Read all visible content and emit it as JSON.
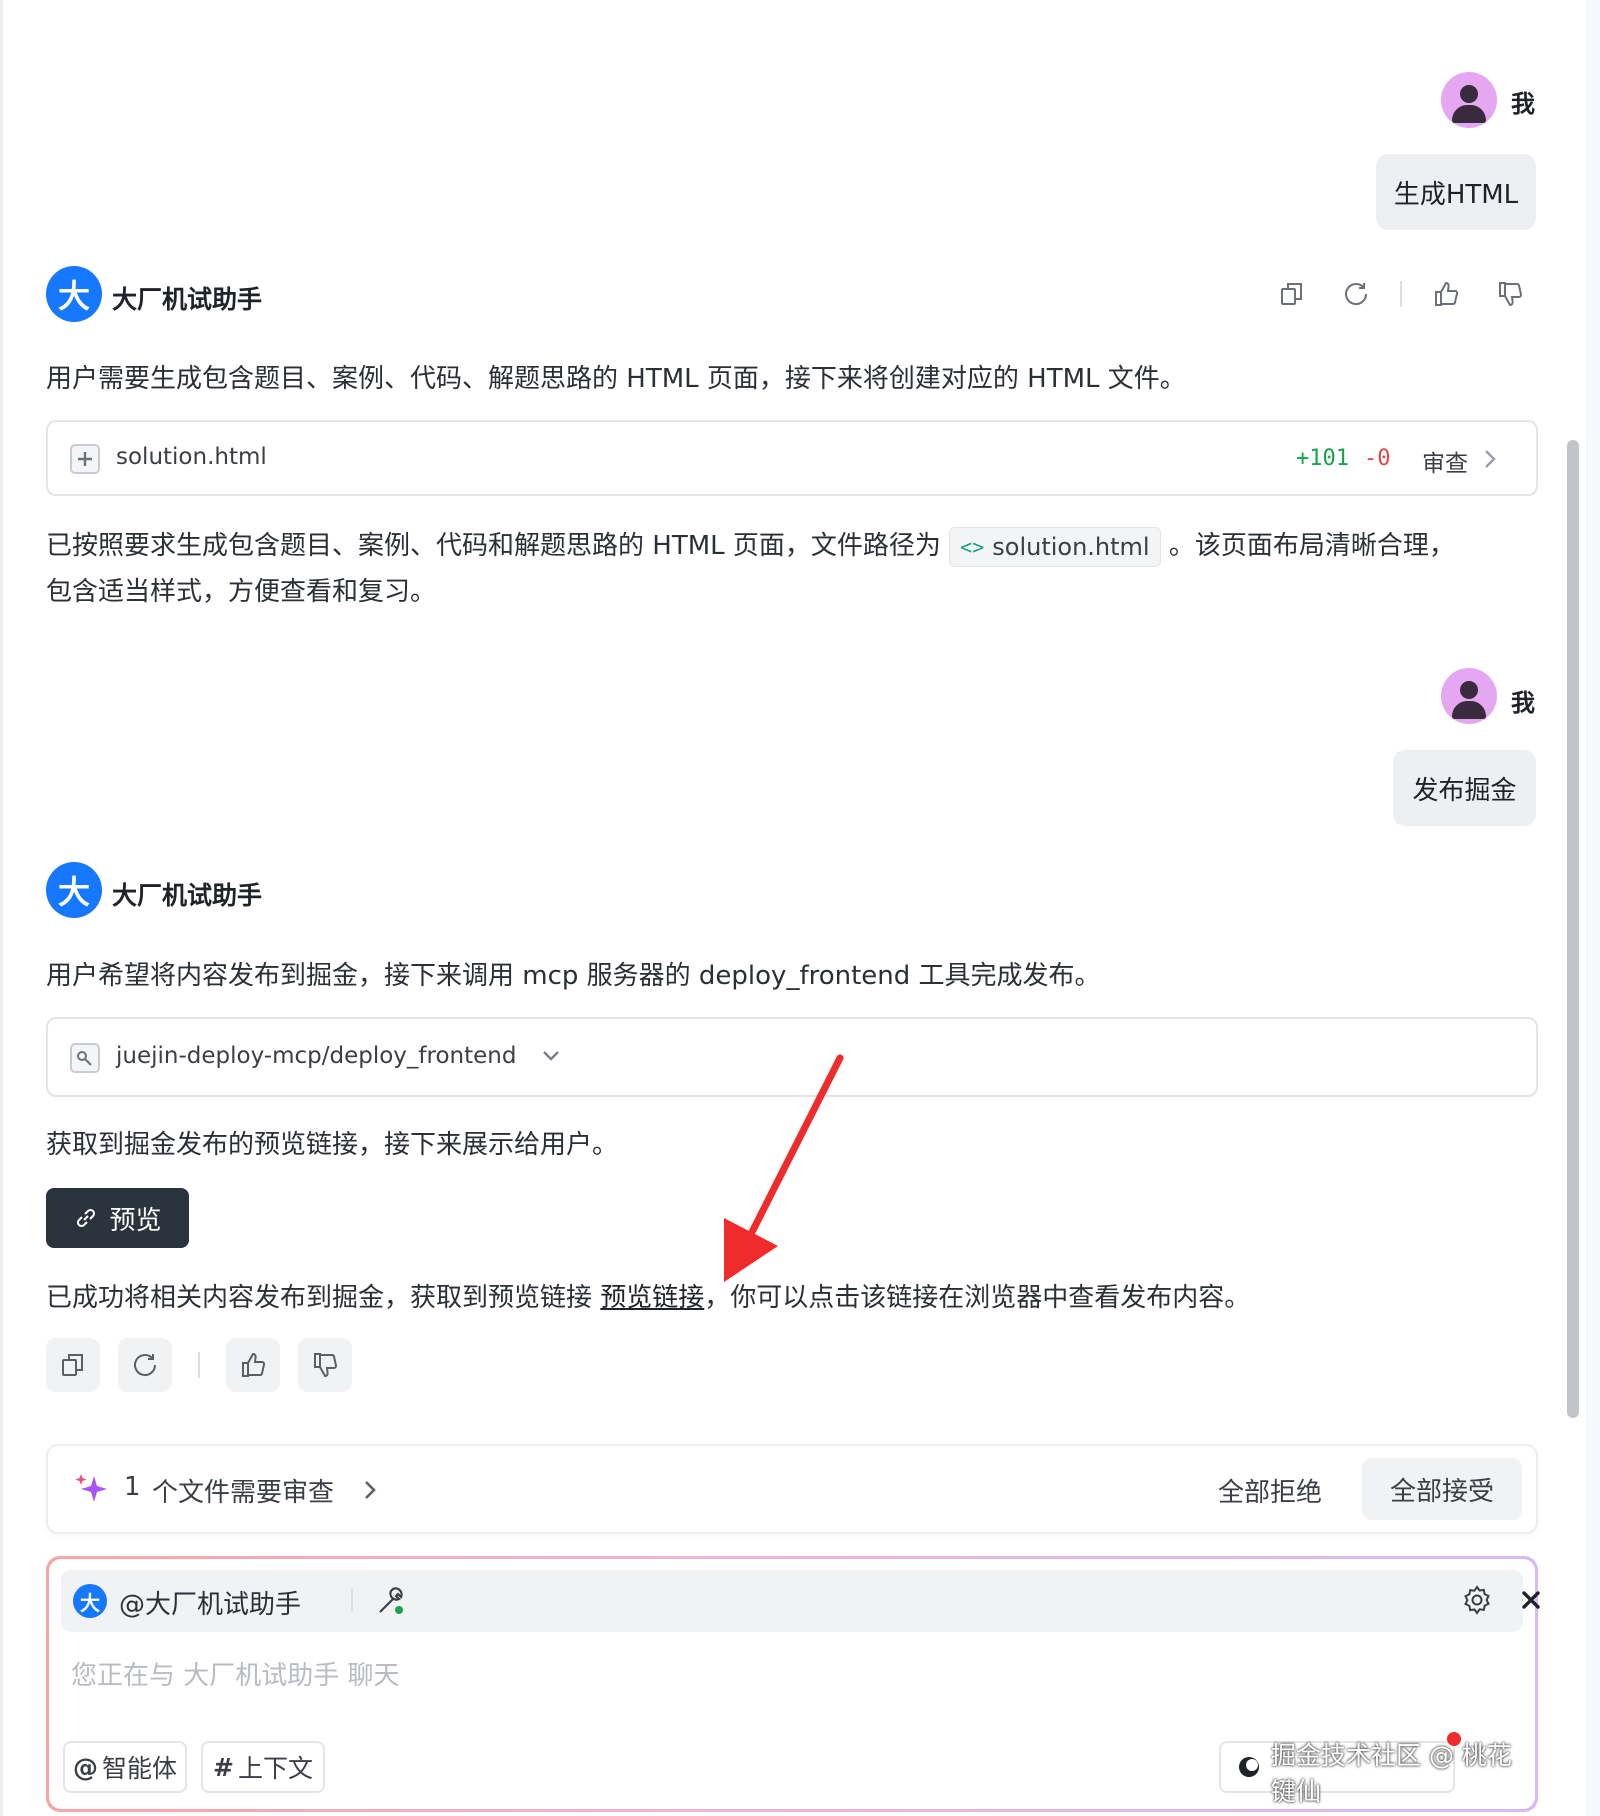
{
  "messages": {
    "m1_user": {
      "name": "我",
      "text": "生成HTML"
    },
    "m2_bot": {
      "name": "大厂机试助手",
      "avatar_char": "大",
      "intro": "用户需要生成包含题目、案例、代码、解题思路的 HTML 页面，接下来将创建对应的 HTML 文件。",
      "file": {
        "name": "solution.html",
        "added": "+101",
        "removed": "-0",
        "review_label": "审查"
      },
      "result_before": "已按照要求生成包含题目、案例、代码和解题思路的 HTML 页面，文件路径为",
      "result_code": "solution.html",
      "result_after": "。该页面布局清晰合理，",
      "result_line2": "包含适当样式，方便查看和复习。"
    },
    "m3_user": {
      "name": "我",
      "text": "发布掘金"
    },
    "m4_bot": {
      "name": "大厂机试助手",
      "avatar_char": "大",
      "intro": "用户希望将内容发布到掘金，接下来调用 mcp 服务器的 deploy_frontend 工具完成发布。",
      "tool": "juejin-deploy-mcp/deploy_frontend",
      "got_link": "获取到掘金发布的预览链接，接下来展示给用户。",
      "preview_label": "预览",
      "final_before": "已成功将相关内容发布到掘金，获取到预览链接",
      "final_link": "预览链接",
      "final_after": "，你可以点击该链接在浏览器中查看发布内容。"
    }
  },
  "review_bar": {
    "count": "1",
    "text": "个文件需要审查",
    "reject_all": "全部拒绝",
    "accept_all": "全部接受"
  },
  "composer": {
    "agent_avatar_char": "大",
    "agent_mention": "@大厂机试助手",
    "placeholder": "您正在与 大厂机试助手 聊天",
    "chip_agent": "智能体",
    "chip_agent_symbol": "@",
    "chip_context": "上下文",
    "chip_context_symbol": "#",
    "watermark": "掘金技术社区 @ 桃花键仙"
  },
  "colors": {
    "brand_blue": "#1677ff",
    "user_avatar": "#e5a7f2",
    "diff_add": "#17a34a",
    "diff_del": "#e54545",
    "preview_button": "#2b333d",
    "arrow": "#f02b2b"
  }
}
